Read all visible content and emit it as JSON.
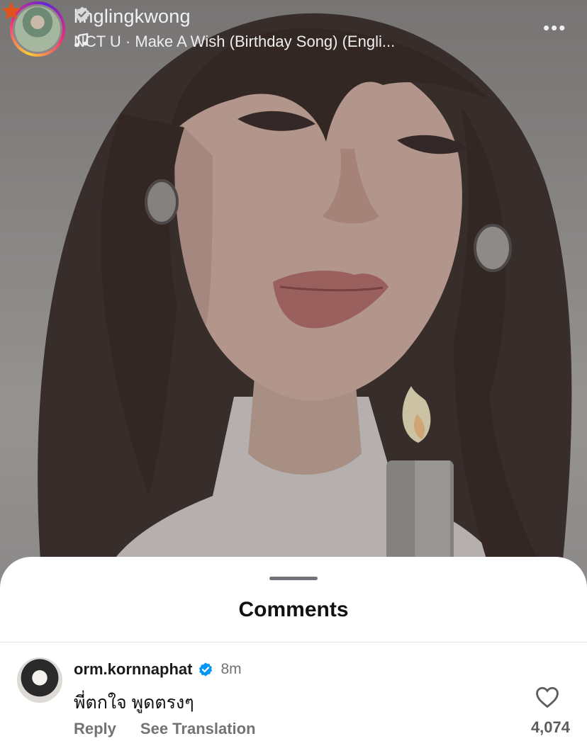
{
  "header": {
    "username": "linglingkwong",
    "verified": true,
    "music": "NCT U · Make A Wish (Birthday Song) (Engli...",
    "icons": [
      "music-note-icon",
      "verified-badge-icon",
      "star-icon",
      "more-icon"
    ],
    "more_label": "•••"
  },
  "sheet": {
    "title": "Comments"
  },
  "comments": [
    {
      "username": "orm.kornnaphat",
      "verified": true,
      "time": "8m",
      "text": "พี่ตกใจ พูดตรงๆ",
      "reply_label": "Reply",
      "translate_label": "See Translation",
      "likes": "4,074"
    }
  ],
  "colors": {
    "verified": "#0095f6",
    "star": "#e0531a",
    "secondary_text": "#737373"
  }
}
